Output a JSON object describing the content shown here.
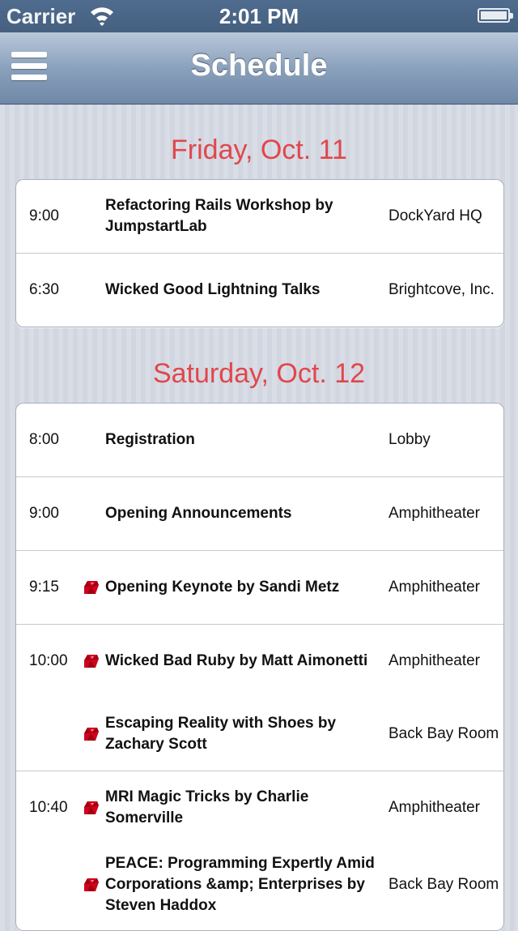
{
  "status": {
    "carrier": "Carrier",
    "time": "2:01 PM"
  },
  "nav": {
    "title": "Schedule"
  },
  "days": [
    {
      "header": "Friday, Oct. 11",
      "slots": [
        {
          "time": "9:00",
          "talks": [
            {
              "title": "Refactoring Rails Workshop by JumpstartLab",
              "room": "DockYard HQ",
              "ruby": false
            }
          ]
        },
        {
          "time": "6:30",
          "talks": [
            {
              "title": "Wicked Good Lightning Talks",
              "room": "Brightcove, Inc.",
              "ruby": false
            }
          ]
        }
      ]
    },
    {
      "header": "Saturday, Oct. 12",
      "slots": [
        {
          "time": "8:00",
          "talks": [
            {
              "title": "Registration",
              "room": "Lobby",
              "ruby": false
            }
          ]
        },
        {
          "time": "9:00",
          "talks": [
            {
              "title": "Opening Announcements",
              "room": "Amphitheater",
              "ruby": false
            }
          ]
        },
        {
          "time": "9:15",
          "talks": [
            {
              "title": "Opening Keynote by Sandi Metz",
              "room": "Amphitheater",
              "ruby": true
            }
          ]
        },
        {
          "time": "10:00",
          "talks": [
            {
              "title": "Wicked Bad Ruby by Matt Aimonetti",
              "room": "Amphitheater",
              "ruby": true
            },
            {
              "title": "Escaping Reality with Shoes by Zachary Scott",
              "room": "Back Bay Room",
              "ruby": true
            }
          ]
        },
        {
          "time": "10:40",
          "talks": [
            {
              "title": "MRI Magic Tricks by Charlie Somerville",
              "room": "Amphitheater",
              "ruby": true
            },
            {
              "title": "PEACE: Programming Expertly Amid Corporations &amp; Enterprises by Steven Haddox",
              "room": "Back Bay Room",
              "ruby": true
            }
          ]
        }
      ]
    }
  ],
  "colors": {
    "section_header": "#e1474b",
    "ruby_icon": "#d0021b"
  },
  "icons": {
    "menu": "hamburger-menu-icon",
    "wifi": "wifi-icon",
    "battery": "battery-icon",
    "ruby": "ruby-gem-icon"
  }
}
